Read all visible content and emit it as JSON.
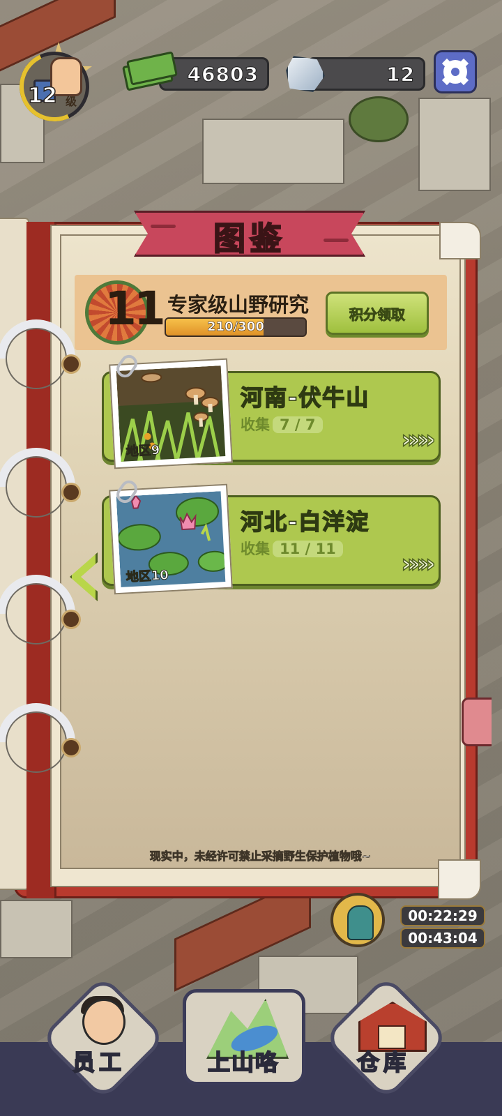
{
  "hud": {
    "level": "12",
    "level_unit": "级",
    "cash": "46803",
    "gems": "12"
  },
  "book": {
    "title": "图鉴",
    "research": {
      "level": "11",
      "title": "专家级山野研究",
      "progress_text": "210/300",
      "progress_fraction": 0.7,
      "claim_label": "积分领取"
    },
    "regions": [
      {
        "name": "河南-伏牛山",
        "collect_label": "收集",
        "count": "7 / 7",
        "area_label": "地区9",
        "arrows": "»»»"
      },
      {
        "name": "河北-白洋淀",
        "collect_label": "收集",
        "count": "11 / 11",
        "area_label": "地区10",
        "arrows": "»»»"
      }
    ],
    "footer_note": "现实中，未经许可禁止采摘野生保护植物哦~"
  },
  "timers": [
    "00:22:29",
    "00:43:04"
  ],
  "nav": {
    "staff": "员工",
    "mountain": "上山咯",
    "warehouse": "仓库"
  },
  "colors": {
    "book_cover": "#b83a2e",
    "ribbon": "#c8475c",
    "card_green": "#aec84f",
    "progress_fill": "#e09228",
    "settings_blue": "#5d6cc6"
  }
}
